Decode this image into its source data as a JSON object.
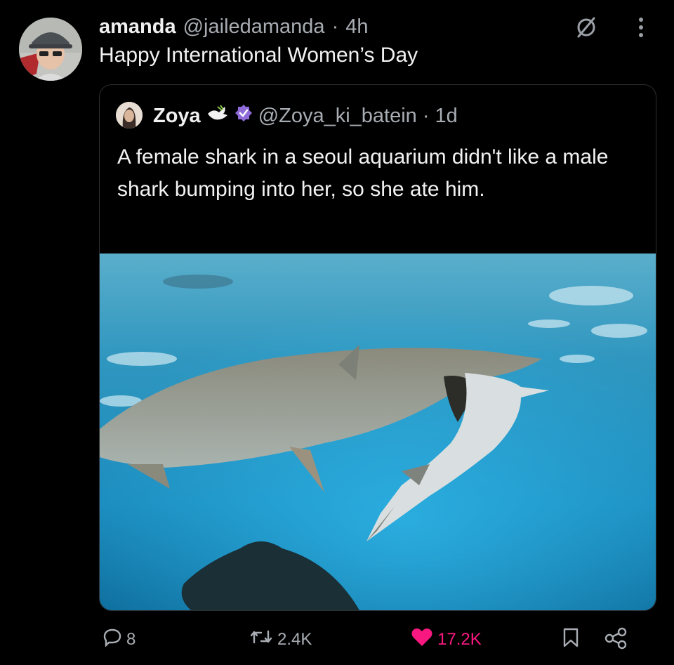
{
  "post": {
    "author_name": "amanda",
    "author_handle": "@jailedamanda",
    "separator": "·",
    "time": "4h",
    "text": "Happy International Women’s Day",
    "mute_icon": "mute-icon",
    "more_icon": "more-icon"
  },
  "quote": {
    "author_name": "Zoya",
    "dove_icon": "dove-icon",
    "verified_icon": "verified-badge-icon",
    "author_handle": "@Zoya_ki_batein",
    "separator": "·",
    "time": "1d",
    "text": "A female shark in a seoul aquarium didn't like a male shark bumping into her, so she ate him."
  },
  "actions": {
    "replies": "8",
    "reposts": "2.4K",
    "likes": "17.2K",
    "like_color": "#f91880"
  }
}
